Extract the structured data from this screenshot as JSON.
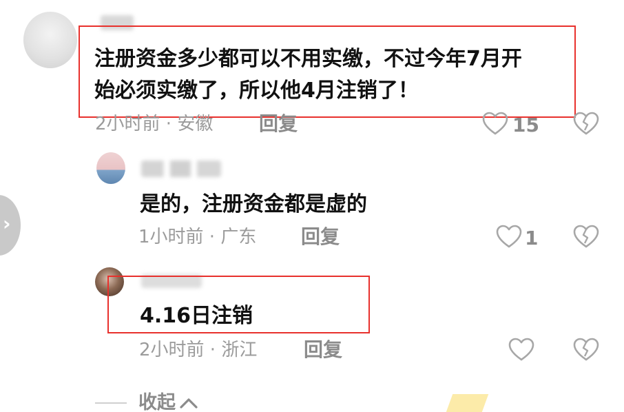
{
  "comments": [
    {
      "username": "██████",
      "text_line1": "注册资金多少都可以不用实缴，不过今年7月开",
      "text_line2": "始必须实缴了，所以他4月注销了！",
      "meta": "2小时前 · 安徽",
      "reply_label": "回复",
      "like_count": "15"
    },
    {
      "username": "██ █ ███",
      "text_line1": "是的，注册资金都是虚的",
      "meta": "1小时前 · 广东",
      "reply_label": "回复",
      "like_count": "1"
    },
    {
      "username": "█████",
      "text_line1": "4.16日注销",
      "meta": "2小时前 · 浙江",
      "reply_label": "回复"
    }
  ],
  "collapse": {
    "label": "收起"
  },
  "colors": {
    "annotation_red": "#e8302c",
    "meta_gray": "#9b9b9b",
    "text_dark": "#111111"
  },
  "icons": {
    "like": "heart-outline-icon",
    "dislike": "broken-heart-icon",
    "collapse": "chevron-up-icon",
    "side_nav": "chevron-right-icon"
  }
}
